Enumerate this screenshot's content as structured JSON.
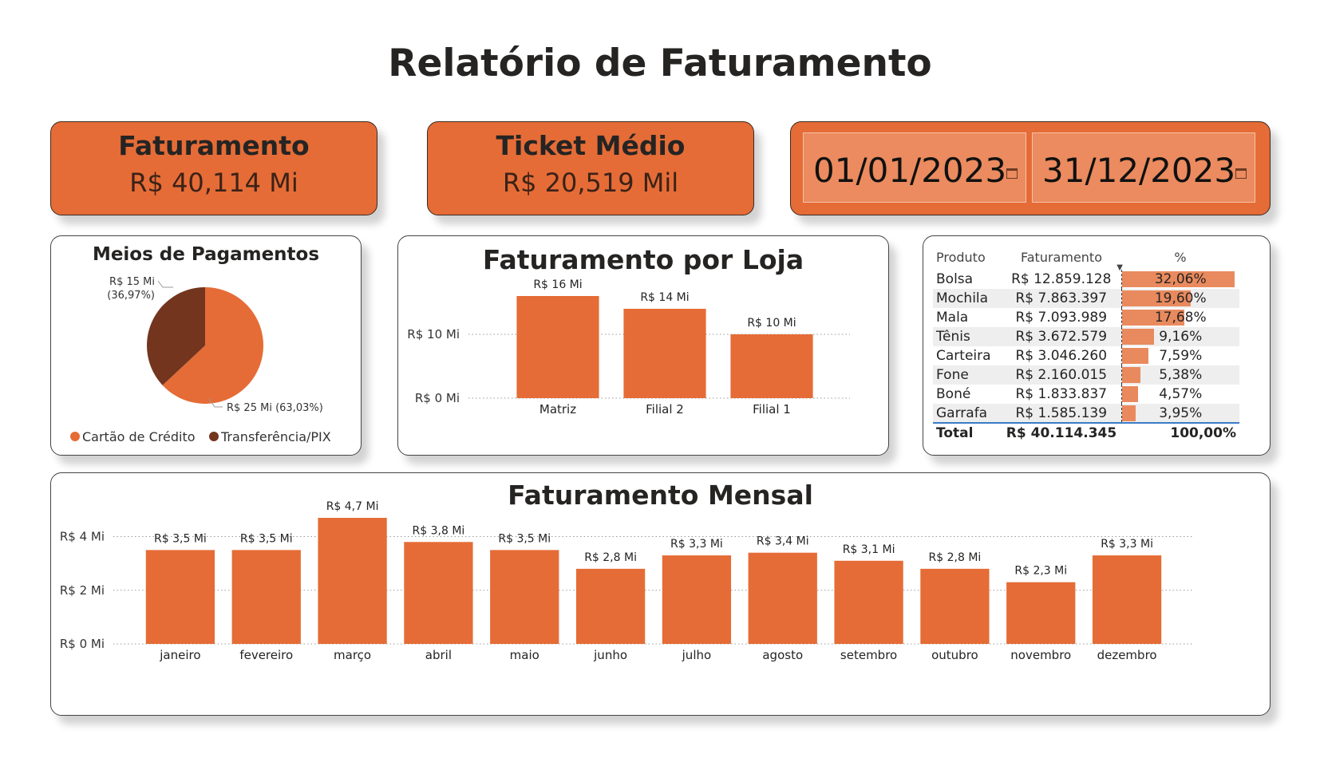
{
  "report_title": "Relatório de Faturamento",
  "kpis": {
    "faturamento": {
      "label": "Faturamento",
      "value": "R$ 40,114 Mi"
    },
    "ticket": {
      "label": "Ticket Médio",
      "value": "R$ 20,519 Mil"
    }
  },
  "dates": {
    "start": "01/01/2023",
    "end": "31/12/2023"
  },
  "colors": {
    "accent": "#e56c36",
    "secondary": "#73351e",
    "table_bar": "#e98a5e",
    "total_line": "#3a7cc8"
  },
  "chart_data": [
    {
      "type": "pie",
      "title": "Meios de Pagamentos",
      "slices": [
        {
          "name": "Cartão de Crédito",
          "value": 25,
          "percent": 63.03,
          "label": "R$ 25 Mi (63,03%)"
        },
        {
          "name": "Transferência/PIX",
          "value": 15,
          "percent": 36.97,
          "label": "R$ 15 Mi",
          "label2": "(36,97%)"
        }
      ],
      "legend": "bottom"
    },
    {
      "type": "bar",
      "title": "Faturamento por Loja",
      "categories": [
        "Matriz",
        "Filial 2",
        "Filial 1"
      ],
      "values": [
        16,
        14,
        10
      ],
      "data_labels": [
        "R$ 16 Mi",
        "R$ 14 Mi",
        "R$ 10 Mi"
      ],
      "yticks": [
        0,
        10
      ],
      "ytick_labels": [
        "R$ 0 Mi",
        "R$ 10 Mi"
      ],
      "ylim": [
        0,
        16
      ]
    },
    {
      "type": "table",
      "columns": [
        "Produto",
        "Faturamento",
        "%"
      ],
      "rows": [
        {
          "produto": "Bolsa",
          "faturamento": "R$ 12.859.128",
          "pct": 32.06,
          "pct_label": "32,06%"
        },
        {
          "produto": "Mochila",
          "faturamento": "R$ 7.863.397",
          "pct": 19.6,
          "pct_label": "19,60%"
        },
        {
          "produto": "Mala",
          "faturamento": "R$ 7.093.989",
          "pct": 17.68,
          "pct_label": "17,68%"
        },
        {
          "produto": "Tênis",
          "faturamento": "R$ 3.672.579",
          "pct": 9.16,
          "pct_label": "9,16%"
        },
        {
          "produto": "Carteira",
          "faturamento": "R$ 3.046.260",
          "pct": 7.59,
          "pct_label": "7,59%"
        },
        {
          "produto": "Fone",
          "faturamento": "R$ 2.160.015",
          "pct": 5.38,
          "pct_label": "5,38%"
        },
        {
          "produto": "Boné",
          "faturamento": "R$ 1.833.837",
          "pct": 4.57,
          "pct_label": "4,57%"
        },
        {
          "produto": "Garrafa",
          "faturamento": "R$ 1.585.139",
          "pct": 3.95,
          "pct_label": "3,95%"
        }
      ],
      "total": {
        "label": "Total",
        "faturamento": "R$ 40.114.345",
        "pct_label": "100,00%"
      }
    },
    {
      "type": "bar",
      "title": "Faturamento Mensal",
      "categories": [
        "janeiro",
        "fevereiro",
        "março",
        "abril",
        "maio",
        "junho",
        "julho",
        "agosto",
        "setembro",
        "outubro",
        "novembro",
        "dezembro"
      ],
      "values": [
        3.5,
        3.5,
        4.7,
        3.8,
        3.5,
        2.8,
        3.3,
        3.4,
        3.1,
        2.8,
        2.3,
        3.3
      ],
      "data_labels": [
        "R$ 3,5 Mi",
        "R$ 3,5 Mi",
        "R$ 4,7 Mi",
        "R$ 3,8 Mi",
        "R$ 3,5 Mi",
        "R$ 2,8 Mi",
        "R$ 3,3 Mi",
        "R$ 3,4 Mi",
        "R$ 3,1 Mi",
        "R$ 2,8 Mi",
        "R$ 2,3 Mi",
        "R$ 3,3 Mi"
      ],
      "yticks": [
        0,
        2,
        4
      ],
      "ytick_labels": [
        "R$ 0 Mi",
        "R$ 2 Mi",
        "R$ 4 Mi"
      ],
      "ylim": [
        0,
        4.7
      ]
    }
  ]
}
